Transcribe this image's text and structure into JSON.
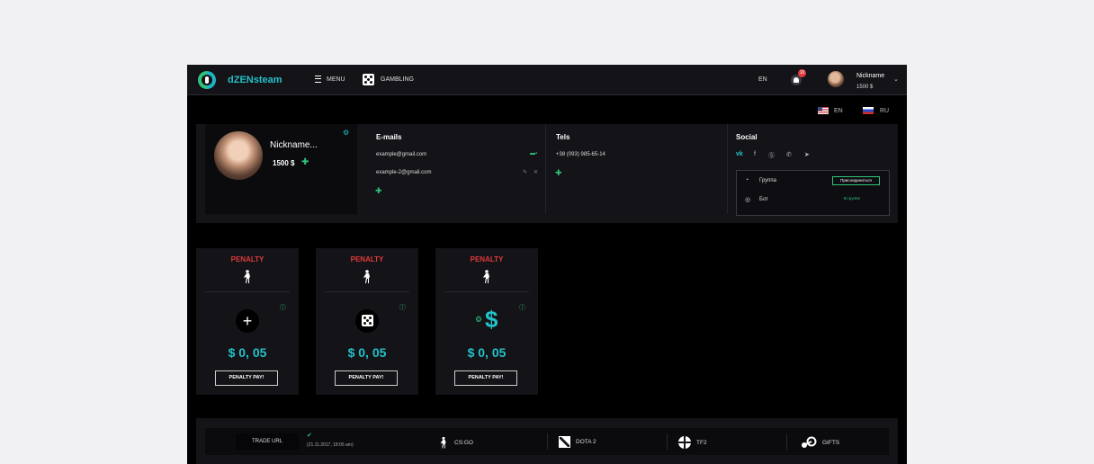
{
  "header": {
    "brand": "dZENsteam",
    "menu_label": "MENU",
    "gambling_label": "GAMBLING",
    "lang": "EN",
    "notifications": "10",
    "nickname": "Nickname",
    "balance": "1500 $"
  },
  "languages": [
    {
      "label": "EN",
      "icon": "us-flag-icon"
    },
    {
      "label": "RU",
      "icon": "ru-flag-icon"
    }
  ],
  "profile": {
    "name": "Nickname...",
    "balance": "1500 $"
  },
  "emails": {
    "title": "E-mails",
    "items": [
      "example@gmail.com",
      "example-2@gmail.com"
    ]
  },
  "tels": {
    "title": "Tels",
    "items": [
      "+38 (093) 985-65-14"
    ]
  },
  "social": {
    "title": "Social",
    "networks": [
      "vk",
      "facebook",
      "skype",
      "whatsapp",
      "telegram"
    ],
    "group_label": "Группа",
    "join_label": "Присоединиться",
    "bot_label": "Бот",
    "bot_status": "В группе"
  },
  "penalties": [
    {
      "title": "PENALTY",
      "icon": "plus-icon",
      "amount": "$ 0, 05",
      "button": "PENALTY PAY!"
    },
    {
      "title": "PENALTY",
      "icon": "dice-icon",
      "amount": "$ 0, 05",
      "button": "PENALTY PAY!"
    },
    {
      "title": "PENALTY",
      "icon": "dollar-gear-icon",
      "amount": "$ 0, 05",
      "button": "PENALTY PAY!"
    }
  ],
  "trade": {
    "label": "TRADE URL",
    "date": "(21.11.2017, 18:05 am)"
  },
  "games": [
    {
      "label": "CS:GO",
      "icon": "csgo-icon"
    },
    {
      "label": "DOTA 2",
      "icon": "dota2-icon"
    },
    {
      "label": "TF2",
      "icon": "tf2-icon"
    },
    {
      "label": "GIFTS",
      "icon": "steam-icon"
    }
  ],
  "colors": {
    "accent": "#24c2c9",
    "green": "#2fc37a",
    "red": "#e03b3b",
    "panel": "#131318"
  }
}
